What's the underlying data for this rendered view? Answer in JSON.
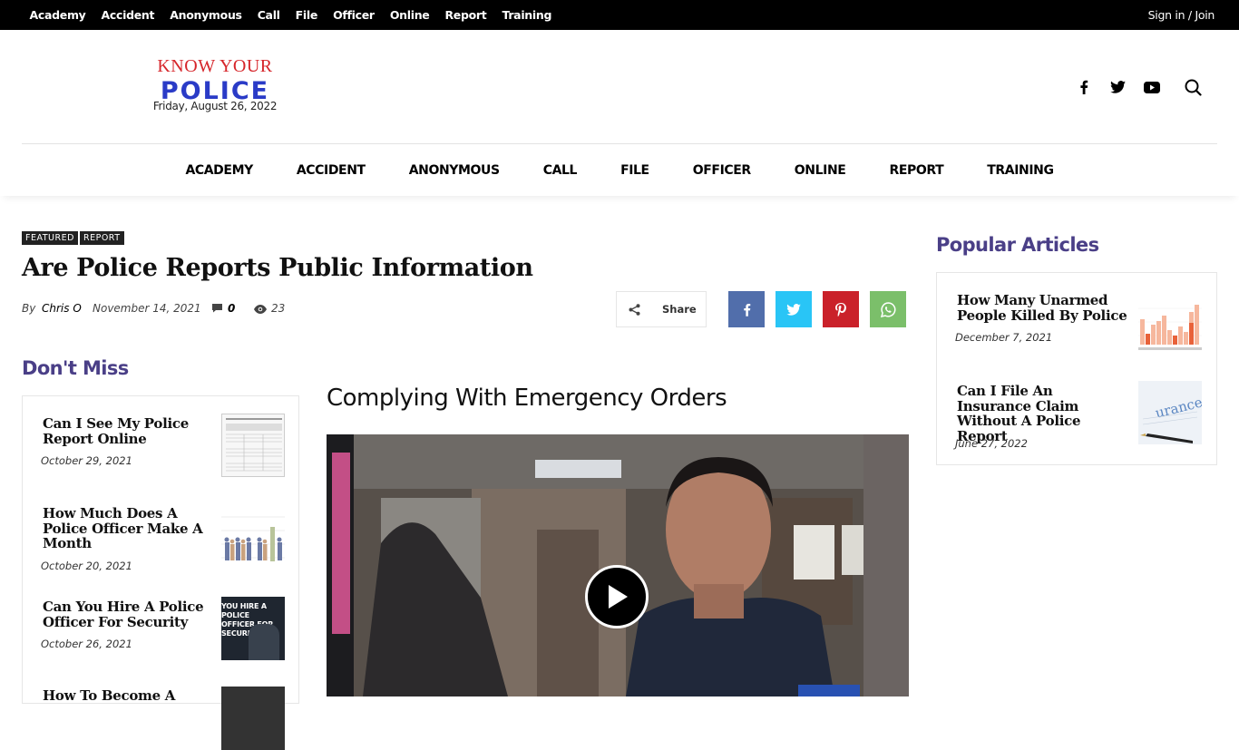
{
  "topbar": {
    "menu": [
      "Academy",
      "Accident",
      "Anonymous",
      "Call",
      "File",
      "Officer",
      "Online",
      "Report",
      "Training"
    ],
    "signin": "Sign in / Join"
  },
  "logo": {
    "line1": "KNOW YOUR",
    "line2": "POLICE",
    "date": "Friday, August 26, 2022"
  },
  "social_icons": [
    "facebook-icon",
    "twitter-icon",
    "youtube-icon",
    "search-icon"
  ],
  "mainnav": [
    "ACADEMY",
    "ACCIDENT",
    "ANONYMOUS",
    "CALL",
    "FILE",
    "OFFICER",
    "ONLINE",
    "REPORT",
    "TRAINING"
  ],
  "article": {
    "tags": [
      "FEATURED",
      "REPORT"
    ],
    "title": "Are Police Reports Public Information",
    "by": "By",
    "author": "Chris O",
    "date": "November 14, 2021",
    "comments": "0",
    "views": "23",
    "share_label": "Share",
    "content_heading": "Complying With Emergency Orders"
  },
  "share_colors": {
    "facebook": "#516eab",
    "twitter": "#29c5f6",
    "pinterest": "#ca212a",
    "whatsapp": "#7bbf6a"
  },
  "dont_miss": {
    "heading": "Don't Miss",
    "items": [
      {
        "title": "Can I See My Police Report Online",
        "date": "October 29, 2021"
      },
      {
        "title": "How Much Does A Police Officer Make A Month",
        "date": "October 20, 2021"
      },
      {
        "title": "Can You Hire A Police Officer For Security",
        "date": "October 26, 2021",
        "thumb_text": "YOU HIRE A POLICE OFFICER FOR SECURITY?"
      },
      {
        "title": "How To Become A",
        "date": ""
      }
    ]
  },
  "popular": {
    "heading": "Popular Articles",
    "items": [
      {
        "title": "How Many Unarmed People Killed By Police",
        "date": "December 7, 2021"
      },
      {
        "title": "Can I File An Insurance Claim Without A Police Report",
        "date": "June 27, 2022",
        "thumb_text": "urance Cl"
      }
    ]
  },
  "accent_color": "#4a3f87"
}
